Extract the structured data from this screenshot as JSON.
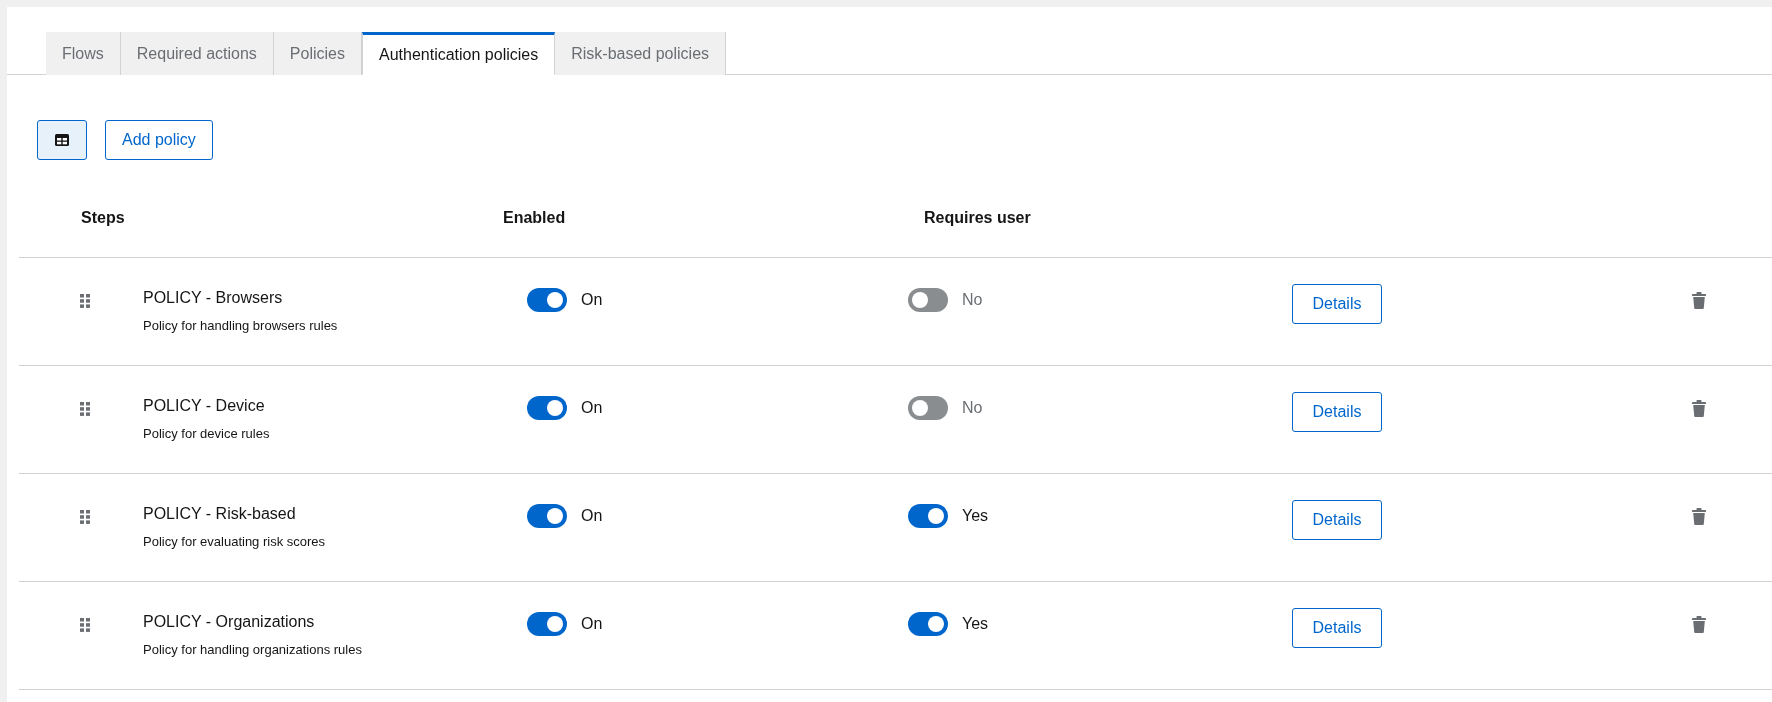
{
  "tabs": [
    {
      "label": "Flows",
      "selected": false
    },
    {
      "label": "Required actions",
      "selected": false
    },
    {
      "label": "Policies",
      "selected": false
    },
    {
      "label": "Authentication policies",
      "selected": true
    },
    {
      "label": "Risk-based policies",
      "selected": false
    }
  ],
  "toolbar": {
    "view_toggle": {
      "selected": true
    },
    "add_button": "Add policy"
  },
  "table": {
    "columns": [
      "Steps",
      "Enabled",
      "Requires user"
    ],
    "rows": [
      {
        "name": "POLICY - Browsers",
        "description": "Policy for handling browsers rules",
        "enabled": {
          "on": true,
          "label": "On"
        },
        "requires_user": {
          "on": false,
          "label": "No"
        },
        "action": "Details"
      },
      {
        "name": "POLICY - Device",
        "description": "Policy for device rules",
        "enabled": {
          "on": true,
          "label": "On"
        },
        "requires_user": {
          "on": false,
          "label": "No"
        },
        "action": "Details"
      },
      {
        "name": "POLICY - Risk-based",
        "description": "Policy for evaluating risk scores",
        "enabled": {
          "on": true,
          "label": "On"
        },
        "requires_user": {
          "on": true,
          "label": "Yes"
        },
        "action": "Details"
      },
      {
        "name": "POLICY - Organizations",
        "description": "Policy for handling organizations rules",
        "enabled": {
          "on": true,
          "label": "On"
        },
        "requires_user": {
          "on": true,
          "label": "Yes"
        },
        "action": "Details"
      }
    ]
  }
}
